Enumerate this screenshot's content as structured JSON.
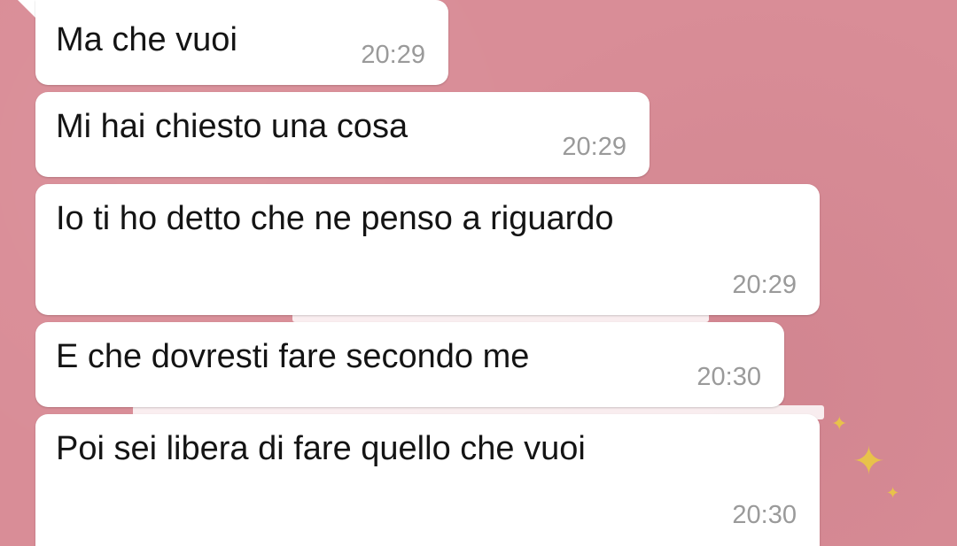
{
  "chat": {
    "messages": [
      {
        "text": "Ma che vuoi",
        "time": "20:29"
      },
      {
        "text": "Mi hai chiesto una cosa",
        "time": "20:29"
      },
      {
        "text": "Io ti ho detto che ne penso a riguardo",
        "time": "20:29"
      },
      {
        "text": "E che dovresti fare secondo me",
        "time": "20:30"
      },
      {
        "text": "Poi sei libera di fare quello che vuoi",
        "time": "20:30"
      }
    ]
  },
  "colors": {
    "wallpaper": "#d98d97",
    "bubble": "#ffffff",
    "message_text": "#141414",
    "timestamp": "#9a9a9a"
  }
}
